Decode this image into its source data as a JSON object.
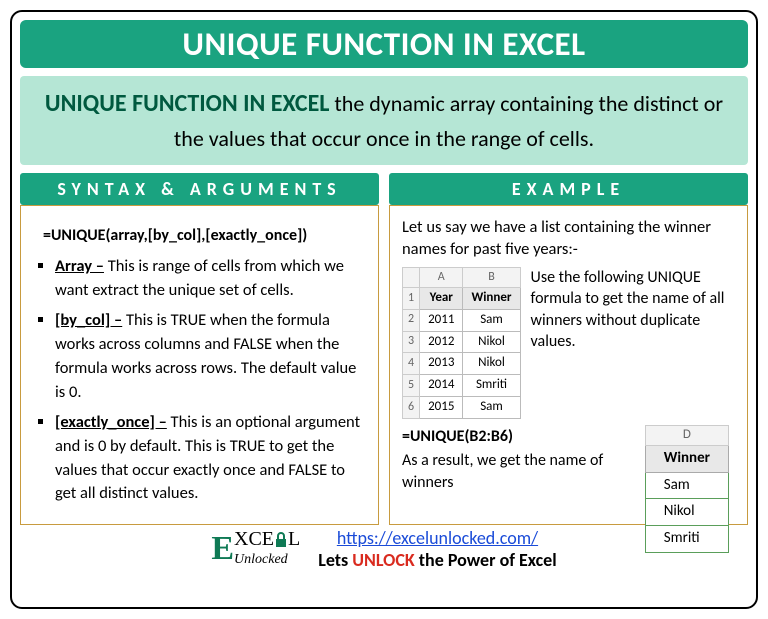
{
  "title": "UNIQUE FUNCTION IN EXCEL",
  "desc": {
    "lead": "UNIQUE FUNCTION IN EXCEL",
    "rest": " the dynamic array containing the distinct or the values that occur once in the range of cells."
  },
  "syntax": {
    "heading": "SYNTAX & ARGUMENTS",
    "formula": "=UNIQUE(array,[by_col],[exactly_once])",
    "args": [
      {
        "name": "Array –",
        "text": " This is range of cells from which we want extract the unique set of cells."
      },
      {
        "name": "[by_col] –",
        "text": " This is TRUE when the formula works across columns and FALSE when the formula works across rows. The default value is 0."
      },
      {
        "name": "[exactly_once] –",
        "text": " This is an optional argument and is 0 by default. This is TRUE to get the values that occur exactly once and FALSE to get all distinct values."
      }
    ]
  },
  "example": {
    "heading": "EXAMPLE",
    "intro": "Let us say we have a list containing the winner names for past five years:-",
    "table": {
      "colA": "A",
      "colB": "B",
      "h1": "Year",
      "h2": "Winner",
      "rows": [
        {
          "n": "1"
        },
        {
          "n": "2",
          "a": "2011",
          "b": "Sam"
        },
        {
          "n": "3",
          "a": "2012",
          "b": "Nikol"
        },
        {
          "n": "4",
          "a": "2013",
          "b": "Nikol"
        },
        {
          "n": "5",
          "a": "2014",
          "b": "Smriti"
        },
        {
          "n": "6",
          "a": "2015",
          "b": "Sam"
        }
      ]
    },
    "instruction": "Use the following UNIQUE formula to get the name of all winners without duplicate values.",
    "formula": "=UNIQUE(B2:B6)",
    "result_intro": "As a result, we get the name of winners",
    "result": {
      "col": "D",
      "header": "Winner",
      "rows": [
        "Sam",
        "Nikol",
        "Smriti"
      ]
    }
  },
  "footer": {
    "logo_top1": "XCE",
    "logo_top2": "L",
    "logo_bottom": "Unlocked",
    "url": "https://excelunlocked.com/",
    "tagline_pre": "Lets ",
    "tagline_mid": "UNLOCK",
    "tagline_post": " the Power of Excel"
  }
}
